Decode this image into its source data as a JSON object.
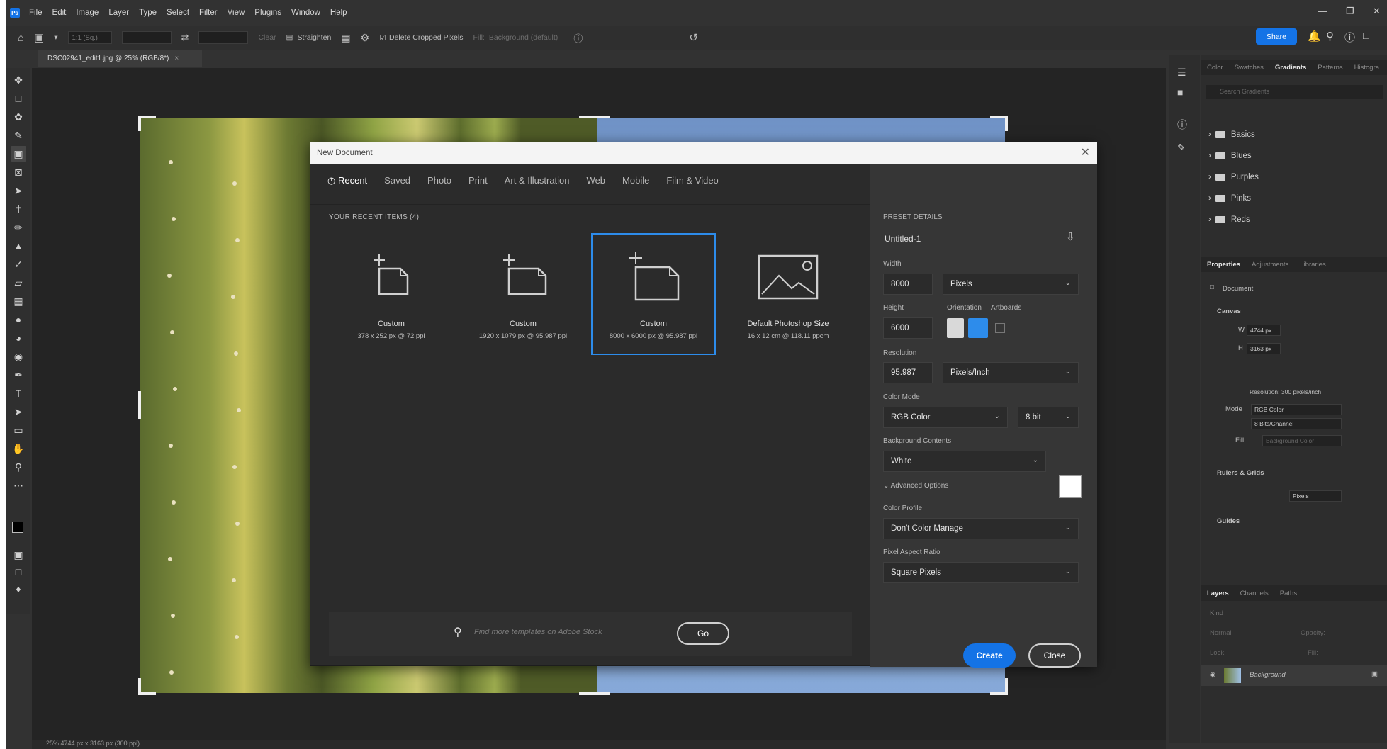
{
  "menubar": {
    "logo": "Ps",
    "items": [
      "File",
      "Edit",
      "Image",
      "Layer",
      "Type",
      "Select",
      "Filter",
      "View",
      "Plugins",
      "Window",
      "Help"
    ]
  },
  "optionsbar": {
    "ratio": "1:1 (Sq.)",
    "clear": "Clear",
    "straighten": "Straighten",
    "delete_cropped": "Delete Cropped Pixels",
    "fill": "Fill:",
    "fill_value": "Background (default)",
    "share": "Share"
  },
  "document_tab": "DSC02941_edit1.jpg @ 25% (RGB/8*)",
  "dialog": {
    "title": "New Document",
    "tabs": [
      "Recent",
      "Saved",
      "Photo",
      "Print",
      "Art & Illustration",
      "Web",
      "Mobile",
      "Film & Video"
    ],
    "recent_title": "YOUR RECENT ITEMS  (4)",
    "items": [
      {
        "name": "Custom",
        "desc": "378 x 252 px @ 72 ppi"
      },
      {
        "name": "Custom",
        "desc": "1920 x 1079 px @ 95.987 ppi"
      },
      {
        "name": "Custom",
        "desc": "8000 x 6000 px @ 95.987 ppi"
      },
      {
        "name": "Default Photoshop Size",
        "desc": "16 x 12 cm @ 118.11 ppcm"
      }
    ],
    "search_placeholder": "Find more templates on Adobe Stock",
    "go": "Go",
    "preset": {
      "header": "PRESET DETAILS",
      "name": "Untitled-1",
      "width_label": "Width",
      "width": "8000",
      "unit": "Pixels",
      "height_label": "Height",
      "height": "6000",
      "orientation_label": "Orientation",
      "artboards_label": "Artboards",
      "resolution_label": "Resolution",
      "resolution": "95.987",
      "resolution_unit": "Pixels/Inch",
      "color_mode_label": "Color Mode",
      "color_mode": "RGB Color",
      "bit_depth": "8 bit",
      "bg_label": "Background Contents",
      "bg": "White",
      "advanced": "Advanced Options",
      "profile_label": "Color Profile",
      "profile": "Don't Color Manage",
      "aspect_label": "Pixel Aspect Ratio",
      "aspect": "Square Pixels"
    },
    "create": "Create",
    "close": "Close"
  },
  "right_panels": {
    "top_tabs": [
      "Color",
      "Swatches",
      "Gradients",
      "Patterns",
      "Histogra"
    ],
    "search_placeholder": "Search Gradients",
    "folders": [
      "Basics",
      "Blues",
      "Purples",
      "Pinks",
      "Reds"
    ],
    "props_tabs": [
      "Properties",
      "Adjustments",
      "Libraries"
    ],
    "document": "Document",
    "canvas": "Canvas",
    "w": "4744 px",
    "h": "3163 px",
    "resolution": "Resolution: 300 pixels/inch",
    "mode_label": "Mode",
    "mode": "RGB Color",
    "bits": "8 Bits/Channel",
    "fill_label": "Fill",
    "fill_value": "Background Color",
    "rulers": "Rulers & Grids",
    "ruler_unit": "Pixels",
    "guides": "Guides",
    "layers_tabs": [
      "Layers",
      "Channels",
      "Paths"
    ],
    "kind": "Kind",
    "normal": "Normal",
    "opacity": "Opacity:",
    "lock": "Lock:",
    "fill2": "Fill:",
    "layer_name": "Background"
  },
  "statusbar": "25%     4744 px x 3163 px (300 ppi)"
}
